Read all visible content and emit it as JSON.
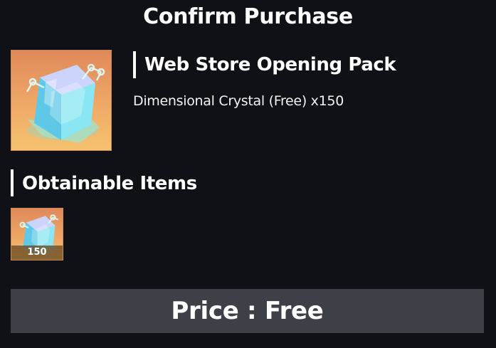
{
  "dialog": {
    "title": "Confirm Purchase"
  },
  "product": {
    "name": "Web Store Opening Pack",
    "contents": "Dimensional Crystal (Free) x150",
    "icon": "dimensional-crystal-icon"
  },
  "obtainable": {
    "heading": "Obtainable Items",
    "items": [
      {
        "icon": "dimensional-crystal-icon",
        "quantity": "150"
      }
    ]
  },
  "price_button": {
    "label": "Price : Free"
  },
  "colors": {
    "background": "#101117",
    "item_bg_top": "#e0895a",
    "item_bg_bottom": "#f5c26f",
    "button_bg": "#3e4047",
    "text": "#ffffff"
  }
}
